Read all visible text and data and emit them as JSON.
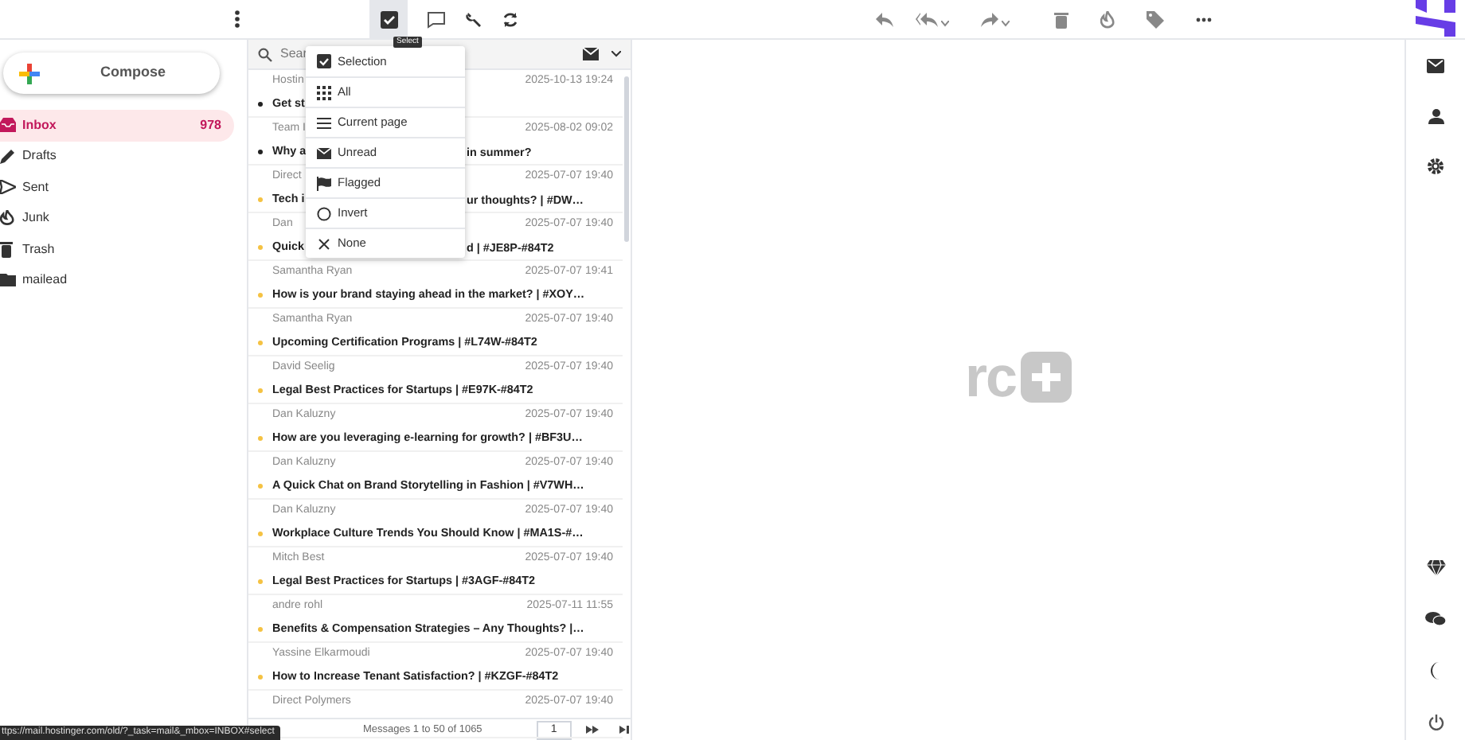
{
  "toolbar": {
    "select_tooltip": "Select"
  },
  "sidebar": {
    "compose": "Compose",
    "folders": [
      {
        "label": "Inbox",
        "count": "978",
        "selected": true
      },
      {
        "label": "Drafts",
        "selected": false
      },
      {
        "label": "Sent",
        "selected": false
      },
      {
        "label": "Junk",
        "selected": false
      },
      {
        "label": "Trash",
        "selected": false
      },
      {
        "label": "mailead",
        "selected": false
      }
    ]
  },
  "message_list": {
    "search": {
      "placeholder": "Sear"
    },
    "messages": [
      {
        "sender": "Hostin",
        "date": "2025-10-13 19:24",
        "subject": "Get st",
        "unread": false
      },
      {
        "sender": "Team I",
        "date": "2025-08-02 09:02",
        "subject": "Why a",
        "subject_tail": "in summer?",
        "unread": false
      },
      {
        "sender": "Direct",
        "date": "2025-07-07 19:40",
        "subject": "Tech i",
        "subject_tail": "ur thoughts? | #DW…",
        "unread": true
      },
      {
        "sender": "Dan",
        "date": "2025-07-07 19:40",
        "subject": "Quick",
        "subject_tail": "d | #JE8P-#84T2",
        "unread": true
      },
      {
        "sender": "Samantha Ryan",
        "date": "2025-07-07 19:41",
        "subject": "How is your brand staying ahead in the market? | #XOY…",
        "unread": true
      },
      {
        "sender": "Samantha Ryan",
        "date": "2025-07-07 19:40",
        "subject": "Upcoming Certification Programs | #L74W-#84T2",
        "unread": true
      },
      {
        "sender": "David Seelig",
        "date": "2025-07-07 19:40",
        "subject": "Legal Best Practices for Startups | #E97K-#84T2",
        "unread": true
      },
      {
        "sender": "Dan Kaluzny",
        "date": "2025-07-07 19:40",
        "subject": "How are you leveraging e-learning for growth? | #BF3U…",
        "unread": true
      },
      {
        "sender": "Dan Kaluzny",
        "date": "2025-07-07 19:40",
        "subject": "A Quick Chat on Brand Storytelling in Fashion | #V7WH…",
        "unread": true
      },
      {
        "sender": "Dan Kaluzny",
        "date": "2025-07-07 19:40",
        "subject": "Workplace Culture Trends You Should Know | #MA1S-#…",
        "unread": true
      },
      {
        "sender": "Mitch Best",
        "date": "2025-07-07 19:40",
        "subject": "Legal Best Practices for Startups | #3AGF-#84T2",
        "unread": true
      },
      {
        "sender": "andre rohl",
        "date": "2025-07-11 11:55",
        "subject": "Benefits & Compensation Strategies – Any Thoughts? |…",
        "unread": true
      },
      {
        "sender": "Yassine Elkarmoudi",
        "date": "2025-07-07 19:40",
        "subject": "How to Increase Tenant Satisfaction? | #KZGF-#84T2",
        "unread": true
      },
      {
        "sender": "Direct Polymers",
        "date": "2025-07-07 19:40"
      }
    ],
    "pagination": {
      "summary": "Messages 1 to 50 of 1065",
      "page": "1"
    }
  },
  "select_menu": [
    {
      "label": "Selection"
    },
    {
      "label": "All"
    },
    {
      "label": "Current page"
    },
    {
      "label": "Unread"
    },
    {
      "label": "Flagged"
    },
    {
      "label": "Invert"
    },
    {
      "label": "None"
    }
  ],
  "preview": {
    "logo_text": "rc"
  },
  "status_url": "ttps://mail.hostinger.com/old/?_task=mail&_mbox=INBOX#select"
}
